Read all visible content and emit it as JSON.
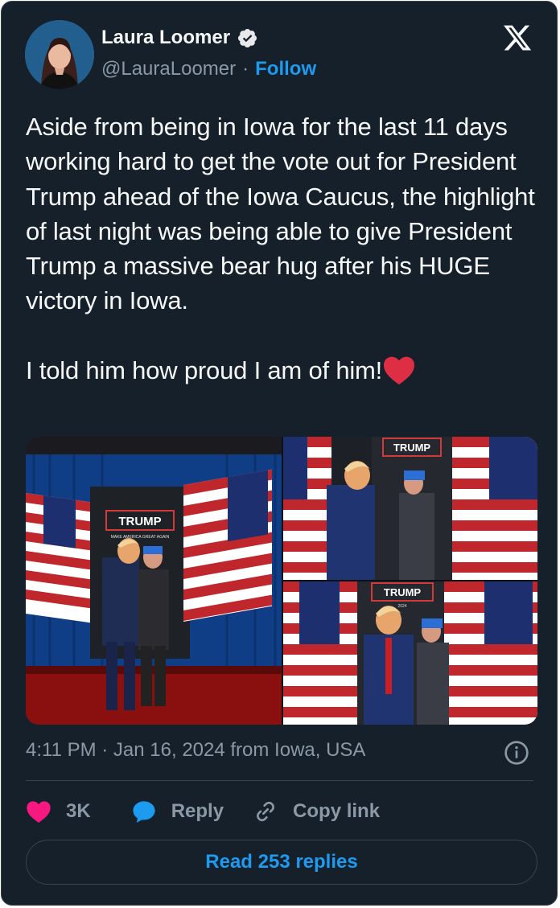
{
  "author": {
    "name": "Laura Loomer",
    "handle": "@LauraLoomer",
    "separator": "·",
    "follow_label": "Follow"
  },
  "tweet": {
    "text": "Aside from being in Iowa for the last 11 days working hard to get the vote out for President Trump ahead of the Iowa Caucus, the highlight of last night was being able to give President Trump a massive bear hug after his HUGE victory in Iowa.\n\nI told him how proud I am of him!"
  },
  "media": {
    "sign_text": "TRUMP",
    "sign_subtext": "MAKE AMERICA GREAT AGAIN",
    "sign_year": "2024"
  },
  "meta": {
    "timestamp": "4:11 PM · Jan 16, 2024 from Iowa, USA"
  },
  "actions": {
    "likes_count": "3K",
    "reply_label": "Reply",
    "copy_label": "Copy link"
  },
  "read_replies_label": "Read 253 replies",
  "colors": {
    "background": "#15202b",
    "accent": "#1d9bf0",
    "like": "#f91880",
    "text": "#f7f9f9",
    "muted": "#8b98a5"
  },
  "icons": [
    "verified-icon",
    "x-logo-icon",
    "red-heart-emoji",
    "info-icon",
    "heart-icon",
    "reply-bubble-icon",
    "link-icon"
  ]
}
